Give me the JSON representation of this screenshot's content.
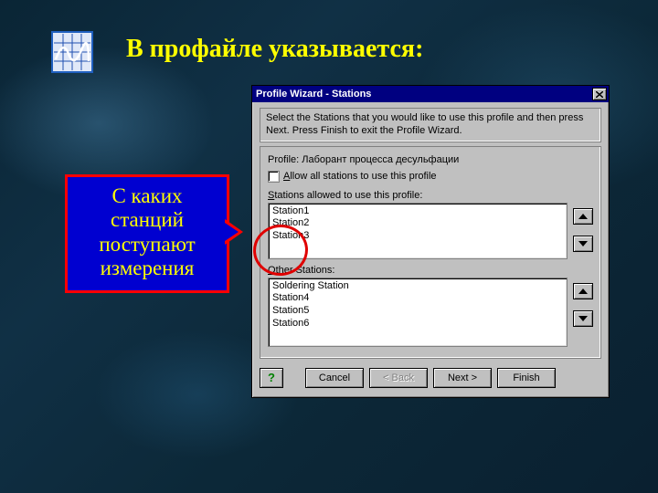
{
  "slide": {
    "title": "В профайле указывается:"
  },
  "callout": {
    "line1": "С каких",
    "line2": "станций",
    "line3": "поступают",
    "line4": "измерения"
  },
  "window": {
    "title": "Profile Wizard - Stations",
    "instructions": "Select the Stations that you would like to use this profile and then press Next.  Press Finish to exit the Profile Wizard.",
    "profile_label": "Profile: Лаборант процесса десульфации",
    "allow_all_prefix": "A",
    "allow_all_rest": "llow all stations to use this profile",
    "allowed_label_prefix": "S",
    "allowed_label_rest": "tations allowed to use this profile:",
    "other_label_prefix": "O",
    "other_label_rest": "ther Stations:",
    "allowed": [
      "Station1",
      "Station2",
      "Station3"
    ],
    "other": [
      "Soldering Station",
      "Station4",
      "Station5",
      "Station6"
    ],
    "buttons": {
      "help": "?",
      "cancel": "Cancel",
      "back": "< Back",
      "next": "Next >",
      "finish": "Finish"
    }
  }
}
